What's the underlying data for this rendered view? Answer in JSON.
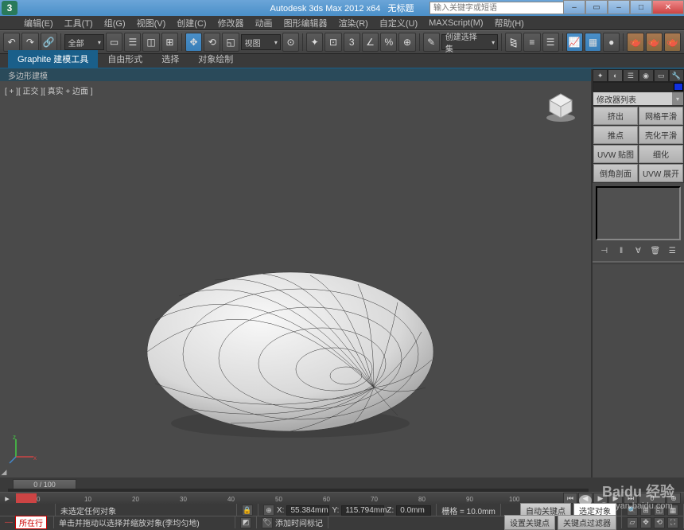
{
  "titlebar": {
    "appname": "Autodesk 3ds Max  2012 x64",
    "docname": "无标题",
    "search_placeholder": "输入关键字或短语"
  },
  "menu": {
    "items": [
      "编辑(E)",
      "工具(T)",
      "组(G)",
      "视图(V)",
      "创建(C)",
      "修改器",
      "动画",
      "图形编辑器",
      "渲染(R)",
      "自定义(U)",
      "MAXScript(M)",
      "帮助(H)"
    ]
  },
  "toolbar": {
    "dd_all": "全部",
    "dd_view": "视图",
    "dd_create": "创建选择集"
  },
  "ribbon": {
    "tabs": [
      "Graphite 建模工具",
      "自由形式",
      "选择",
      "对象绘制"
    ],
    "sublabel": "多边形建模"
  },
  "viewport": {
    "label": "[ + ][ 正交 ][ 真实 + 边面 ]"
  },
  "rightpanel": {
    "modifier_list": "修改器列表",
    "buttons": [
      [
        "挤出",
        "网格平滑"
      ],
      [
        "推点",
        "壳化平滑"
      ],
      [
        "UVW 贴图",
        "细化"
      ],
      [
        "倒角剖面",
        "UVW 展开"
      ]
    ]
  },
  "timeline": {
    "pos": "0 / 100"
  },
  "track": {
    "labels": [
      "0",
      "10",
      "20",
      "30",
      "40",
      "50",
      "60",
      "70",
      "80",
      "90",
      "100"
    ]
  },
  "status": {
    "noselect": "未选定任何对象",
    "x_label": "X:",
    "x_val": "55.384mm",
    "y_label": "Y:",
    "y_val": "115.794mm",
    "z_label": "Z:",
    "z_val": "0.0mm",
    "grid_label": "栅格 = 10.0mm",
    "autokey": "自动关键点",
    "selobj_btn": "选定对象",
    "suoxing": "所在行",
    "hint": "单击并拖动以选择并缩放对象(李均匀地)",
    "addtime": "添加时间标记",
    "setkey": "设置关键点",
    "keyfilter": "关键点过滤器"
  },
  "watermark": {
    "brand": "Baidu 经验",
    "url": "jingyan.baidu.com"
  }
}
